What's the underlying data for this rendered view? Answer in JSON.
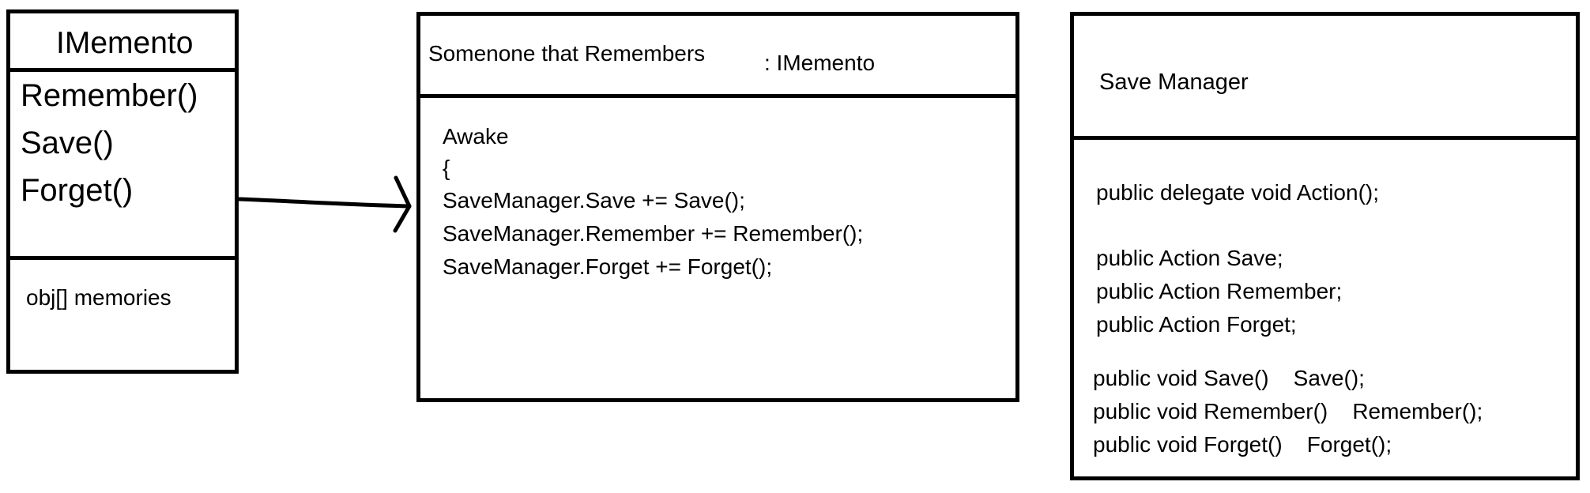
{
  "imemento": {
    "title": "IMemento",
    "methods": [
      "Remember()",
      "Save()",
      "Forget()"
    ],
    "field": "obj[] memories"
  },
  "someone": {
    "title": "Somenone that Remembers",
    "interface": ": IMemento",
    "code": [
      "Awake",
      "{",
      "SaveManager.Save += Save();",
      "SaveManager.Remember += Remember();",
      "SaveManager.Forget += Forget();"
    ]
  },
  "save_manager": {
    "title": "Save Manager",
    "code": [
      "public delegate void Action();",
      "public Action Save;",
      "public Action Remember;",
      "public Action Forget;",
      "public void Save()    Save();",
      "public void Remember()    Remember();",
      "public void Forget()    Forget();"
    ]
  }
}
